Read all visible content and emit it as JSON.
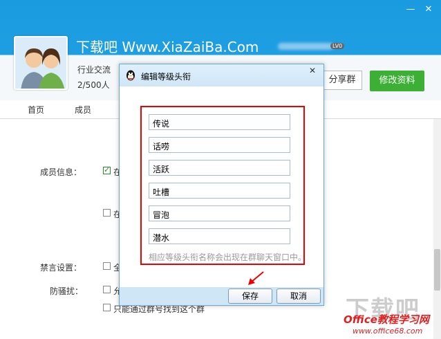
{
  "header": {
    "group_title": "下载吧 Www.XiaZaiBa.Com",
    "level_badge": "LV0",
    "category": "行业交流",
    "member_count": "2/500人",
    "share_button": "分享群",
    "edit_button": "修改资料",
    "colors": {
      "header_blue": "#1f9fe2",
      "edit_green": "#3cb035"
    }
  },
  "window": {
    "minimize": "—",
    "close": "✕"
  },
  "tabs": [
    {
      "label": "首页"
    },
    {
      "label": "成员"
    }
  ],
  "settings": {
    "member_info_label": "成员信息：",
    "mute_label": "禁言设置：",
    "anti_spam_label": "防骚扰：",
    "row_text_1": "在",
    "row_text_2": "在",
    "row_text_3": "全",
    "row_text_4": "允",
    "row_text_5": "只能通过群号找到这个群"
  },
  "dialog": {
    "title": "编辑等级头衔",
    "close": "✕",
    "titles": [
      "传说",
      "话唠",
      "活跃",
      "吐槽",
      "冒泡",
      "潜水"
    ],
    "hint": "相应等级头衔名称会出现在群聊天窗口中。",
    "save_button": "保存",
    "cancel_button": "取消",
    "highlight_color": "#ee0000"
  },
  "watermark": {
    "line1": "下载吧",
    "line2": "Office教程学习网",
    "line3": "www.office68.com"
  }
}
